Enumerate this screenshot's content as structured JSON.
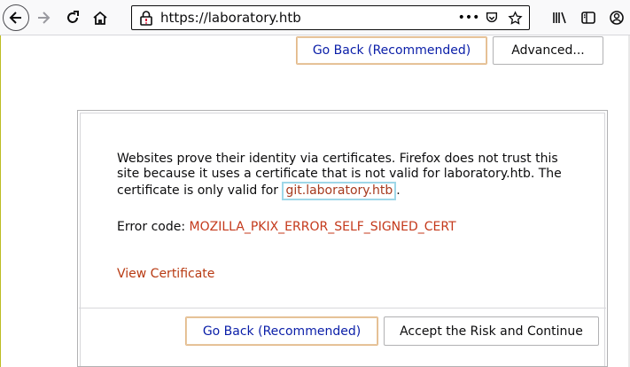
{
  "browser": {
    "url": "https://laboratory.htb",
    "icons": {
      "back": "arrow-left-icon",
      "forward": "arrow-right-icon",
      "reload": "reload-icon",
      "home": "home-icon",
      "lock": "warning-lock-icon",
      "more": "ellipsis-icon",
      "pocket": "pocket-icon",
      "bookmark": "star-icon",
      "library": "library-icon",
      "sidebar": "sidebar-icon",
      "account": "account-icon"
    }
  },
  "top_actions": {
    "go_back": "Go Back (Recommended)",
    "advanced": "Advanced..."
  },
  "panel": {
    "description_part1": "Websites prove their identity via certificates. Firefox does not trust this site because it uses a certificate that is not valid for laboratory.htb. The certificate is only valid for ",
    "cert_host": "git.laboratory.htb",
    "description_end": ".",
    "error_label": "Error code: ",
    "error_code": "MOZILLA_PKIX_ERROR_SELF_SIGNED_CERT",
    "view_certificate": "View Certificate",
    "go_back": "Go Back (Recommended)",
    "accept": "Accept the Risk and Continue"
  },
  "colors": {
    "link_blue": "#0a1ea8",
    "error_red": "#c4391b",
    "focus_cyan": "#9fd7e8"
  }
}
